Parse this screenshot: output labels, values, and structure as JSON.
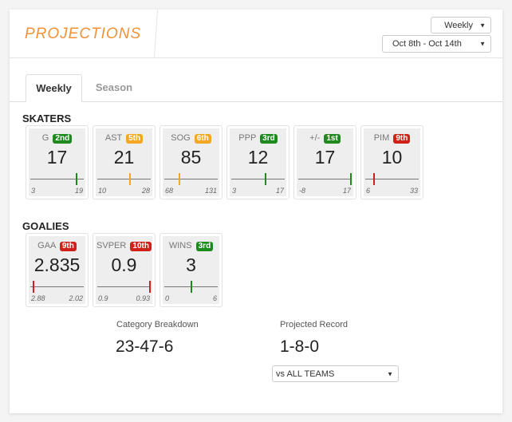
{
  "header": {
    "title": "PROJECTIONS",
    "period_select": {
      "value": "Weekly",
      "arrow": "▼"
    },
    "range_select": {
      "value": "Oct 8th - Oct 14th",
      "arrow": "▼"
    }
  },
  "tabs": [
    {
      "label": "Weekly",
      "active": true
    },
    {
      "label": "Season",
      "active": false
    }
  ],
  "colors": {
    "accent": "#f39235",
    "good": "#1e8a1e",
    "mid": "#f5a623",
    "bad": "#d0201a"
  },
  "skaters": {
    "label": "SKATERS",
    "stats": [
      {
        "name": "G",
        "rank": "2nd",
        "rank_level": "good",
        "value": "17",
        "min": "3",
        "max": "19",
        "position_fraction": 0.88
      },
      {
        "name": "AST",
        "rank": "5th",
        "rank_level": "mid",
        "value": "21",
        "min": "10",
        "max": "28",
        "position_fraction": 0.61
      },
      {
        "name": "SOG",
        "rank": "6th",
        "rank_level": "mid",
        "value": "85",
        "min": "68",
        "max": "131",
        "position_fraction": 0.27
      },
      {
        "name": "PPP",
        "rank": "3rd",
        "rank_level": "good",
        "value": "12",
        "min": "3",
        "max": "17",
        "position_fraction": 0.64
      },
      {
        "name": "+/-",
        "rank": "1st",
        "rank_level": "good",
        "value": "17",
        "min": "-8",
        "max": "17",
        "position_fraction": 1.0
      },
      {
        "name": "PIM",
        "rank": "9th",
        "rank_level": "bad",
        "value": "10",
        "min": "6",
        "max": "33",
        "position_fraction": 0.15
      }
    ]
  },
  "goalies": {
    "label": "GOALIES",
    "stats": [
      {
        "name": "GAA",
        "rank": "9th",
        "rank_level": "bad",
        "value": "2.835",
        "min": "2.88",
        "max": "2.02",
        "position_fraction": 0.05
      },
      {
        "name": "SVPER",
        "rank": "10th",
        "rank_level": "bad",
        "value": "0.9",
        "min": "0.9",
        "max": "0.93",
        "position_fraction": 1.0
      },
      {
        "name": "WINS",
        "rank": "3rd",
        "rank_level": "good",
        "value": "3",
        "min": "0",
        "max": "6",
        "position_fraction": 0.5
      }
    ]
  },
  "summary": {
    "category_breakdown": {
      "label": "Category Breakdown",
      "value": "23-47-6"
    },
    "projected_record": {
      "label": "Projected Record",
      "value": "1-8-0"
    },
    "opponent_select": {
      "value": "vs ALL TEAMS",
      "arrow": "▼"
    }
  }
}
